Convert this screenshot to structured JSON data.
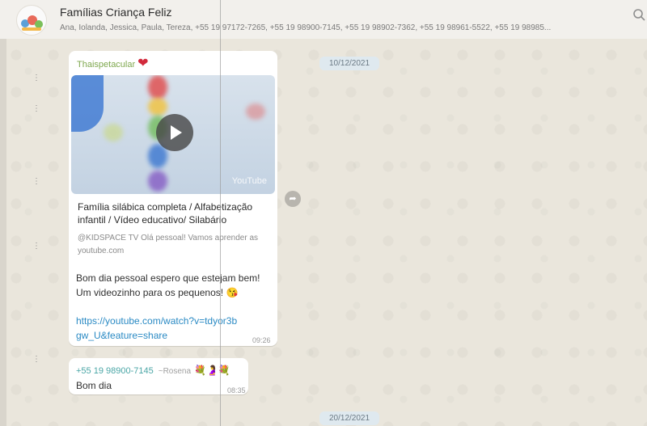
{
  "header": {
    "group_name": "Famílias Criança Feliz",
    "members": "Ana, Iolanda, Jessica, Paula, Tereza, +55 19 97172-7265, +55 19 98900-7145, +55 19 98902-7362, +55 19 98961-5522, +55 19 98985...",
    "right_icon": "search-icon"
  },
  "dates": [
    "10/12/2021",
    "20/12/2021"
  ],
  "message1": {
    "sender": "Thaispetacular",
    "heart": "❤",
    "video_logo": "YouTube",
    "link_title": "Família silábica completa / Alfabetização infantil / Vídeo educativo/ Silabário",
    "link_desc": "@KIDSPACE TV Olá pessoal! Vamos aprender as",
    "link_domain": "youtube.com",
    "text": "Bom dia pessoal espero que estejam bem! Um videozinho para os pequenos! 😘",
    "url": "https://youtube.com/watch?v=tdyor3bgw_U&feature=share",
    "time": "09:26"
  },
  "message2": {
    "phone": "+55 19 98900-7145",
    "alias": "~Rosena",
    "emojis": "💐🤰💐",
    "text": "Bom dia",
    "time": "08:35"
  },
  "colors": {
    "sender_name": "#7fa84f",
    "link": "#2a8ac4",
    "phone": "#4aa6a6"
  }
}
